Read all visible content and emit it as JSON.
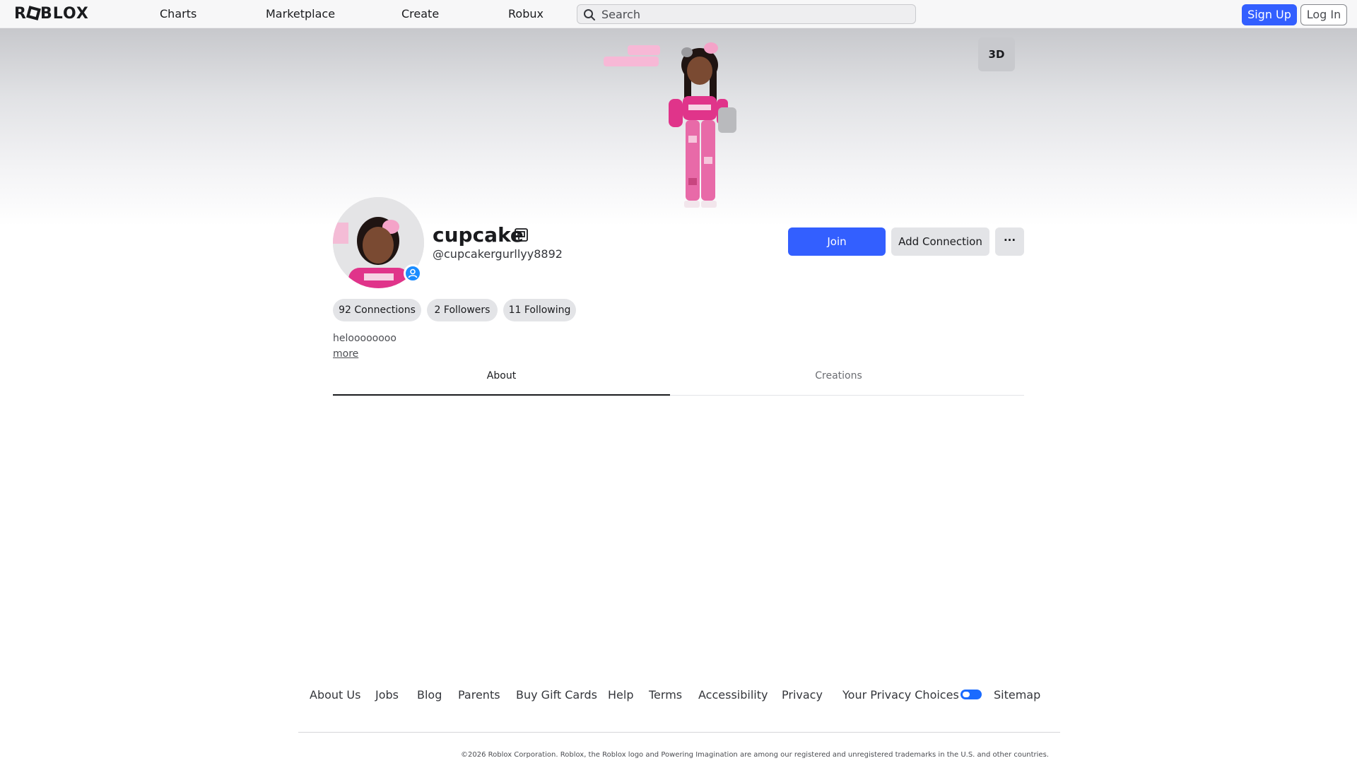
{
  "nav": {
    "logo": "ROBLOX",
    "links": [
      "Charts",
      "Marketplace",
      "Create",
      "Robux"
    ],
    "search_placeholder": "Search",
    "signup": "Sign Up",
    "login": "Log In"
  },
  "banner": {
    "view_toggle": "3D",
    "accent_color": "#e0348a"
  },
  "profile": {
    "display_name": "cupcake",
    "username": "@cupcakergurllyy8892",
    "join": "Join",
    "add_connection": "Add Connection",
    "more_menu": "···",
    "stats": [
      "92 Connections",
      "2 Followers",
      "11 Following"
    ],
    "bio": "heloooooooo",
    "more_link": "more"
  },
  "tabs": [
    "About",
    "Creations"
  ],
  "footer": {
    "links": [
      "About Us",
      "Jobs",
      "Blog",
      "Parents",
      "Buy Gift Cards",
      "Help",
      "Terms",
      "Accessibility",
      "Privacy",
      "Your Privacy Choices",
      "Sitemap"
    ],
    "copyright": "©2026 Roblox Corporation. Roblox, the Roblox logo and Powering Imagination are among our registered and unregistered trademarks in the U.S. and other countries."
  },
  "colors": {
    "primary": "#335fff",
    "presence": "#1a8cff"
  }
}
